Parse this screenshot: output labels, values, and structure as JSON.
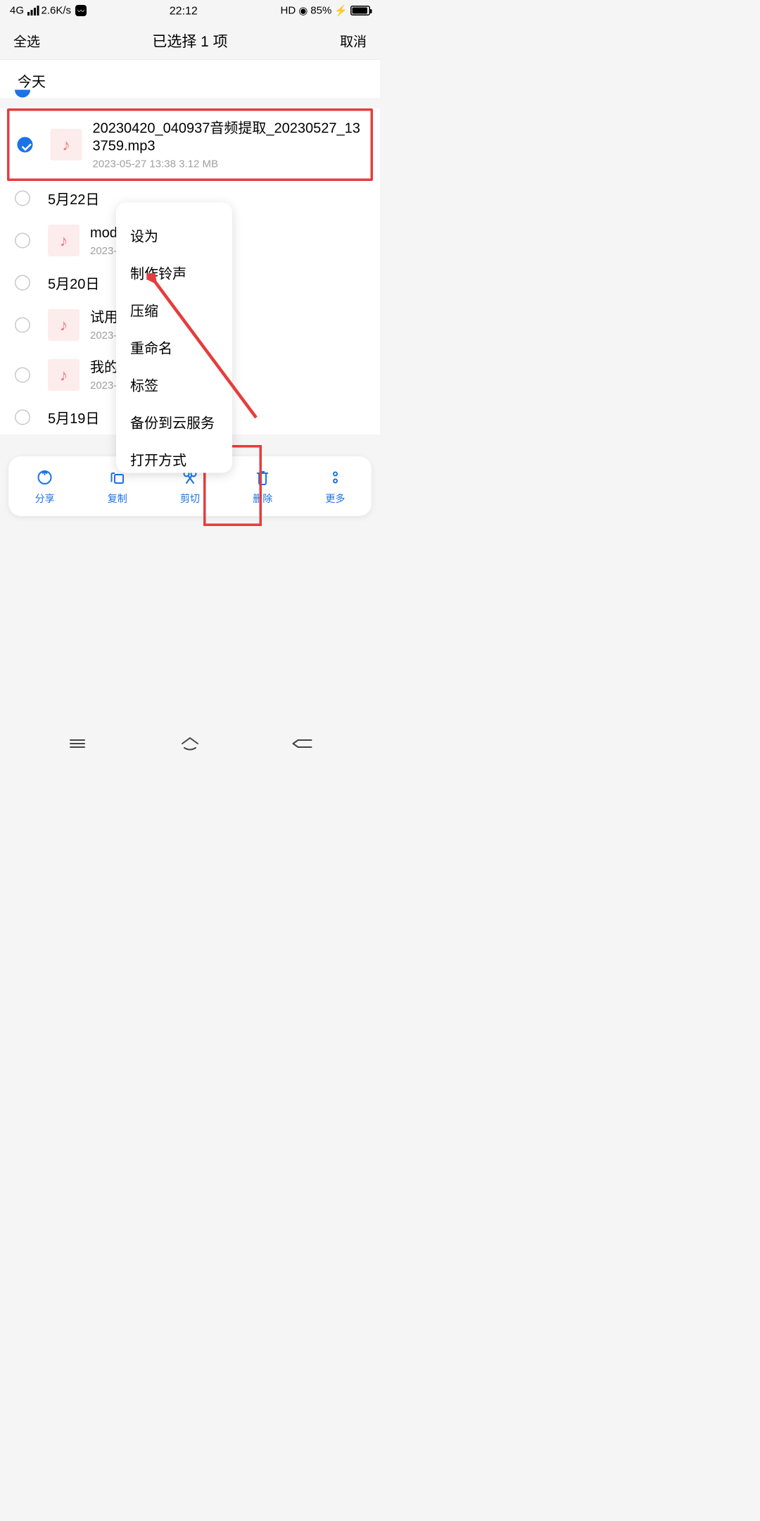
{
  "statusbar": {
    "network": "4G",
    "speed": "2.6K/s",
    "time": "22:12",
    "hd": "HD",
    "battery_pct": "85%"
  },
  "appbar": {
    "select_all": "全选",
    "title": "已选择 1 项",
    "cancel": "取消"
  },
  "section": {
    "today": "今天"
  },
  "files": [
    {
      "name": "20230420_040937音频提取_20230527_133759.mp3",
      "info": "2023-05-27 13:38   3.12 MB",
      "checked": true
    },
    {
      "date_header": "5月22日"
    },
    {
      "name": "mode",
      "info": "2023-05",
      "checked": false
    },
    {
      "date_header": "5月20日"
    },
    {
      "name": "试用_…_2023",
      "info": "2023-05",
      "checked": false
    },
    {
      "name": "我的声",
      "info": "2023-05",
      "checked": false
    },
    {
      "date_header": "5月19日"
    }
  ],
  "popup": {
    "items": [
      "设为",
      "制作铃声",
      "压缩",
      "重命名",
      "标签",
      "备份到云服务",
      "打开方式"
    ]
  },
  "bottombar": {
    "share": "分享",
    "copy": "复制",
    "cut": "剪切",
    "delete": "删除",
    "more": "更多"
  }
}
